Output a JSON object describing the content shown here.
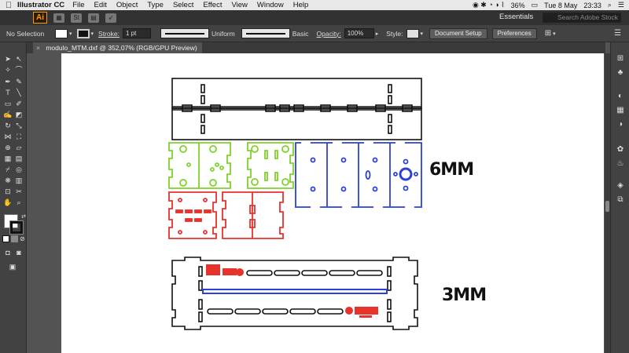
{
  "menubar": {
    "apple": "",
    "app_name": "Illustrator CC",
    "menus": [
      "File",
      "Edit",
      "Object",
      "Type",
      "Select",
      "Effect",
      "View",
      "Window",
      "Help"
    ],
    "battery": "36%",
    "date": "Tue 8 May",
    "time": "23:33"
  },
  "appbar": {
    "logo": "Ai",
    "workspace": "Essentials",
    "search_placeholder": "Search Adobe Stock"
  },
  "controlbar": {
    "selection": "No Selection",
    "stroke_label": "Stroke:",
    "stroke_weight": "1 pt",
    "profile": "Uniform",
    "brush": "Basic",
    "opacity_label": "Opacity:",
    "opacity": "100%",
    "style_label": "Style:",
    "document_setup": "Document Setup",
    "preferences": "Preferences"
  },
  "tab": {
    "close": "×",
    "title": "modulo_MTM.dxf @ 352,07% (RGB/GPU Preview)"
  },
  "labels": {
    "thick": "6MM",
    "thin": "3MM"
  },
  "colors": {
    "green": "#7fd32a",
    "blue": "#2b40d6",
    "red": "#e8322c",
    "black": "#111111"
  }
}
